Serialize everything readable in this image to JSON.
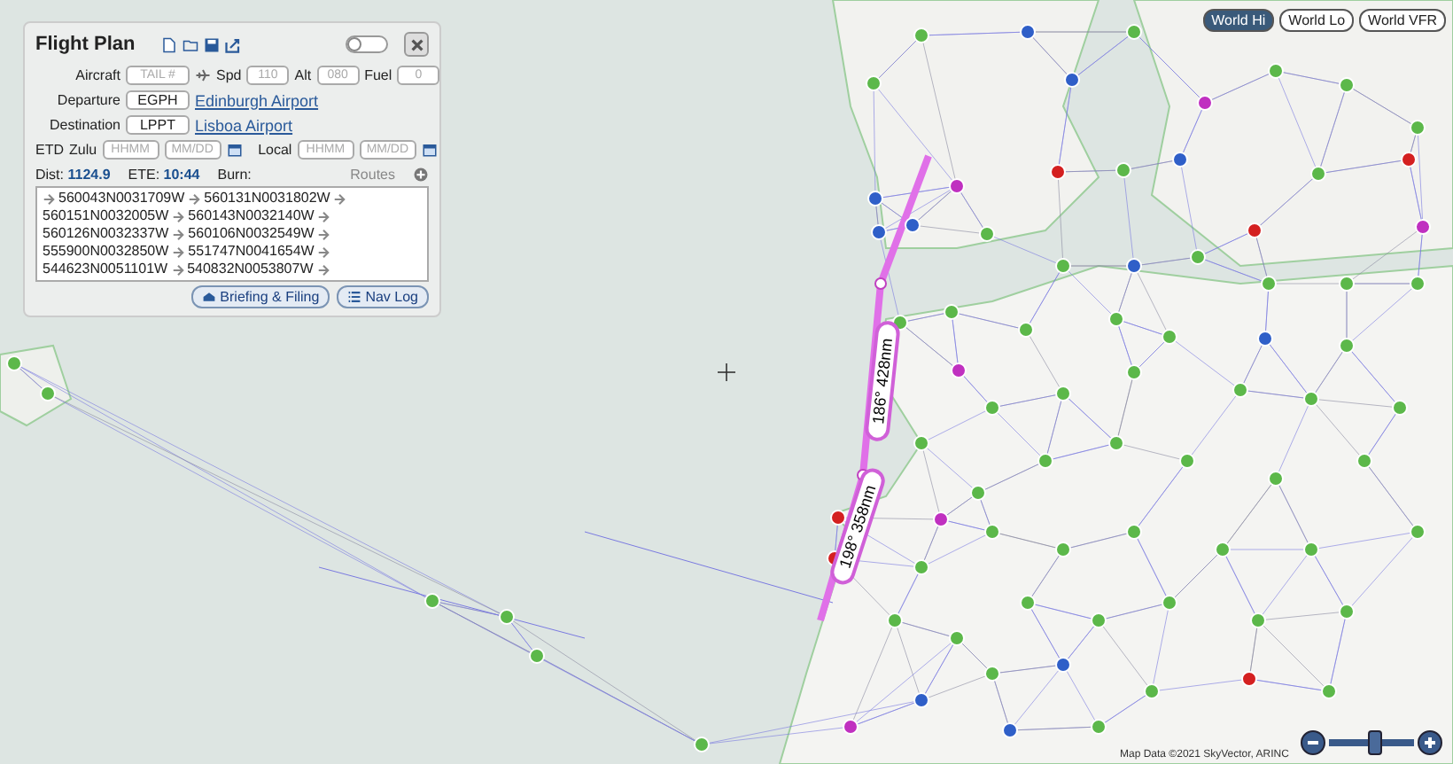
{
  "flight_plan": {
    "title": "Flight Plan",
    "toggle_on": false,
    "aircraft": {
      "label": "Aircraft",
      "placeholder": "TAIL #"
    },
    "speed": {
      "label": "Spd",
      "placeholder": "110"
    },
    "altitude": {
      "label": "Alt",
      "placeholder": "080"
    },
    "fuel": {
      "label": "Fuel",
      "placeholder": "0"
    },
    "departure": {
      "label": "Departure",
      "value": "EGPH",
      "airport": "Edinburgh Airport"
    },
    "destination": {
      "label": "Destination",
      "value": "LPPT",
      "airport": "Lisboa Airport"
    },
    "etd": {
      "label": "ETD",
      "zulu_label": "Zulu",
      "zulu_time_placeholder": "HHMM",
      "zulu_date_placeholder": "MM/DD",
      "local_label": "Local",
      "local_time_placeholder": "HHMM",
      "local_date_placeholder": "MM/DD"
    },
    "dist": {
      "label": "Dist:",
      "value": "1124.9"
    },
    "ete": {
      "label": "ETE:",
      "value": "10:44"
    },
    "burn": {
      "label": "Burn:"
    },
    "routes_label": "Routes",
    "route": [
      "560043N0031709W",
      "560131N0031802W",
      "560151N0032005W",
      "560143N0032140W",
      "560126N0032337W",
      "560106N0032549W",
      "555900N0032850W",
      "551747N0041654W",
      "544623N0051101W",
      "540832N0053807W"
    ],
    "buttons": [
      "Briefing & Filing",
      "Nav Log"
    ]
  },
  "map_layers": [
    {
      "label": "World Hi",
      "selected": true
    },
    {
      "label": "World Lo",
      "selected": false
    },
    {
      "label": "World VFR",
      "selected": false
    }
  ],
  "route_legs": [
    "186° 428nm",
    "198° 358nm"
  ],
  "zoom": {
    "level": 0.55
  },
  "attribution": "Map Data ©2021 SkyVector, ARINC"
}
